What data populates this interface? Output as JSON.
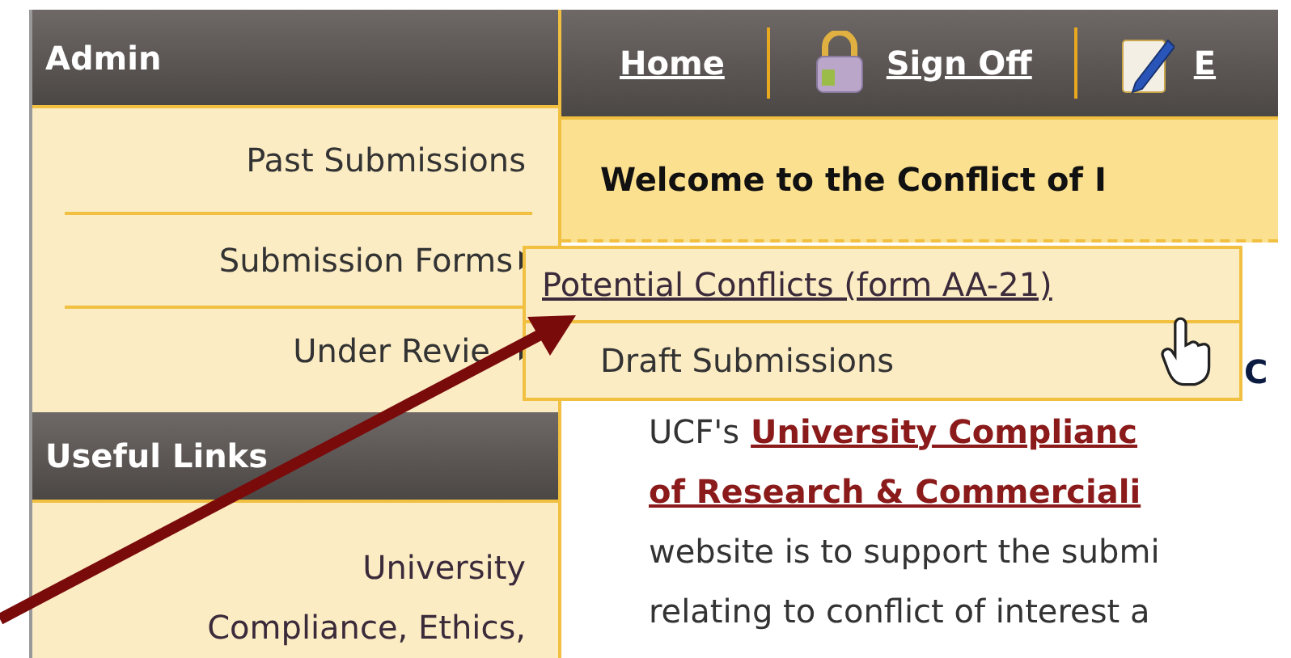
{
  "sidebar": {
    "admin": {
      "title": "Admin",
      "items": [
        {
          "label": "Past Submissions",
          "has_submenu": false
        },
        {
          "label": "Submission Forms",
          "has_submenu": true
        },
        {
          "label": "Under Revie",
          "has_submenu": true
        }
      ]
    },
    "useful_links": {
      "title": "Useful Links",
      "lines": [
        "University",
        "Compliance, Ethics,"
      ]
    }
  },
  "nav": [
    {
      "label": "Home",
      "kind": "plain"
    },
    {
      "label": "Sign Off",
      "kind": "lock"
    },
    {
      "label": "E",
      "kind": "edit"
    }
  ],
  "banner": {
    "title": "Welcome to the Conflict of I"
  },
  "submenu": [
    {
      "label": "Potential Conflicts (form AA-21)",
      "selected": true
    },
    {
      "label": "Draft Submissions",
      "selected": false
    }
  ],
  "body": {
    "heading": "C",
    "lines": [
      {
        "segments": [
          {
            "text": "UCF's",
            "link": false
          },
          {
            "text": "University Complianc",
            "link": true
          }
        ]
      },
      {
        "segments": [
          {
            "text": "of Research & Commerciali",
            "link": true
          }
        ]
      },
      {
        "segments": [
          {
            "text": "website is to support the submi",
            "link": false
          }
        ]
      },
      {
        "segments": [
          {
            "text": "relating to conflict of interest a",
            "link": false
          }
        ]
      }
    ]
  }
}
